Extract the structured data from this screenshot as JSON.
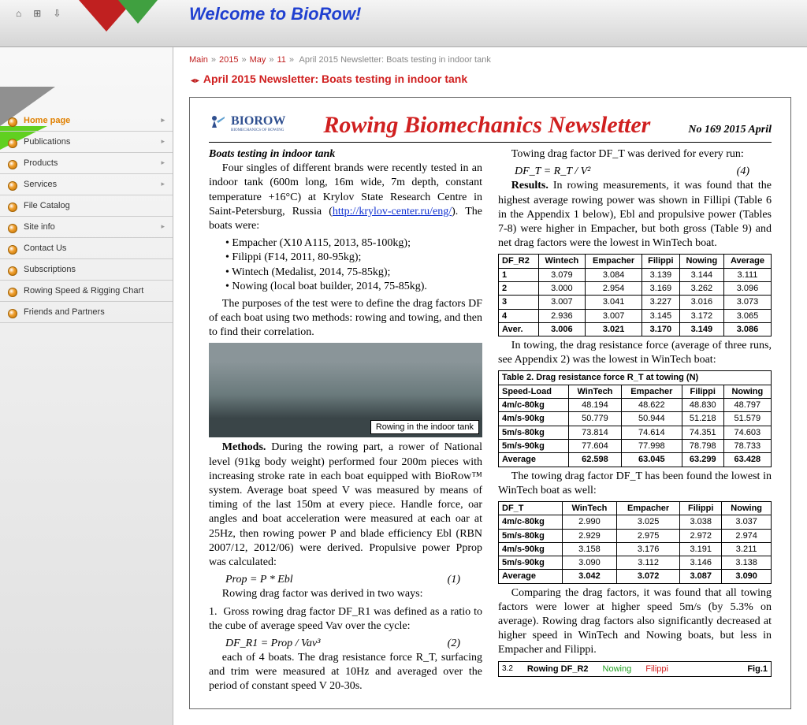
{
  "header": {
    "title": "Welcome to BioRow!"
  },
  "sidebar": {
    "items": [
      {
        "label": "Home page",
        "active": true,
        "expand": true
      },
      {
        "label": "Publications",
        "active": false,
        "expand": true
      },
      {
        "label": "Products",
        "active": false,
        "expand": true
      },
      {
        "label": "Services",
        "active": false,
        "expand": true
      },
      {
        "label": "File Catalog",
        "active": false,
        "expand": false
      },
      {
        "label": "Site info",
        "active": false,
        "expand": true
      },
      {
        "label": "Contact Us",
        "active": false,
        "expand": false
      },
      {
        "label": "Subscriptions",
        "active": false,
        "expand": false
      },
      {
        "label": "Rowing Speed & Rigging Chart",
        "active": false,
        "expand": false
      },
      {
        "label": "Friends and Partners",
        "active": false,
        "expand": false
      }
    ]
  },
  "breadcrumb": {
    "parts": [
      "Main",
      "2015",
      "May",
      "11"
    ],
    "current": "April 2015 Newsletter: Boats testing in indoor tank"
  },
  "page": {
    "title": "April 2015 Newsletter: Boats testing in indoor tank"
  },
  "doc": {
    "logo": "BIOROW",
    "logo_sub": "BIOMECHANICS OF ROWING",
    "title": "Rowing Biomechanics Newsletter",
    "issue": "No 169 2015 April",
    "section_title": "Boats testing in indoor tank",
    "intro": "Four singles of different brands were recently tested in an indoor tank (600m long, 16m wide, 7m depth, constant temperature +16°C) at Krylov State Research Centre in Saint-Petersburg, Russia (",
    "intro_link": "http://krylov-center.ru/eng/",
    "intro2": "). The boats were:",
    "boats": [
      "Empacher (X10 A115, 2013, 85-100kg);",
      "Filippi (F14, 2011, 80-95kg);",
      "Wintech (Medalist, 2014, 75-85kg);",
      "Nowing (local boat builder, 2014, 75-85kg)."
    ],
    "purpose": "The purposes of the test were to define the drag factors DF of each boat using two methods: rowing and towing, and then to find their correlation.",
    "fig_caption": "Rowing in the indoor tank",
    "methods_label": "Methods.",
    "methods": " During the rowing part, a rower of National level (91kg body weight) performed four 200m pieces with increasing stroke rate in each boat equipped with BioRow™ system. Average boat speed V was measured by means of timing of the last 150m at every piece. Handle force, oar angles and boat acceleration were measured at each oar at 25Hz, then rowing power P and blade efficiency Ebl (RBN 2007/12, 2012/06) were derived. Propulsive power Pprop was calculated:",
    "eq1": "Prop = P * Ebl",
    "eq1n": "(1)",
    "drag_intro": "Rowing drag factor was derived in two ways:",
    "gross": "Gross rowing drag factor DF_R1 was defined as a ratio to the cube of average speed Vav over the cycle:",
    "eq2": "DF_R1 = Prop / Vav³",
    "eq2n": "(2)",
    "col2_intro": "each of 4 boats. The drag resistance force R_T, surfacing and trim were measured at 10Hz and averaged over the period of constant speed V 20-30s.",
    "towing_line": "Towing drag factor DF_T was derived for every run:",
    "eq4": "DF_T = R_T / V²",
    "eq4n": "(4)",
    "results_label": "Results.",
    "results": " In rowing measurements, it was found that the highest average rowing power was shown in Fillipi (Table 6 in the Appendix 1 below), Ebl and propulsive power (Tables 7-8) were higher in Empacher, but both gross (Table 9) and net drag factors were the lowest in WinTech boat.",
    "towing_text": "In towing, the drag resistance force (average of three runs, see Appendix 2) was the lowest in WinTech boat:",
    "table2_caption": "Table 2. Drag resistance force R_T at towing (N)",
    "dft_text": "The towing drag factor DF_T has been found the lowest in WinTech boat as well:",
    "compare": "Comparing the drag factors, it was found that all towing factors were lower at higher speed 5m/s (by 5.3% on average). Rowing drag factors also significantly decreased at higher speed in WinTech and Nowing boats, but less in Empacher and Filippi.",
    "fig1": {
      "y": "3.2",
      "title": "Rowing DF_R2",
      "series": [
        "Nowing",
        "Filippi"
      ],
      "label": "Fig.1"
    }
  },
  "chart_data": [
    {
      "type": "table",
      "title": "DF_R2",
      "categories": [
        "Wintech",
        "Empacher",
        "Filippi",
        "Nowing",
        "Average"
      ],
      "rows": [
        {
          "label": "1",
          "values": [
            3.079,
            3.084,
            3.139,
            3.144,
            3.111
          ]
        },
        {
          "label": "2",
          "values": [
            3.0,
            2.954,
            3.169,
            3.262,
            3.096
          ]
        },
        {
          "label": "3",
          "values": [
            3.007,
            3.041,
            3.227,
            3.016,
            3.073
          ]
        },
        {
          "label": "4",
          "values": [
            2.936,
            3.007,
            3.145,
            3.172,
            3.065
          ]
        },
        {
          "label": "Aver.",
          "values": [
            3.006,
            3.021,
            3.17,
            3.149,
            3.086
          ]
        }
      ]
    },
    {
      "type": "table",
      "title": "Table 2. Drag resistance force R_T at towing (N)",
      "categories": [
        "WinTech",
        "Empacher",
        "Filippi",
        "Nowing"
      ],
      "row_label": "Speed-Load",
      "rows": [
        {
          "label": "4m/c-80kg",
          "values": [
            48.194,
            48.622,
            48.83,
            48.797
          ]
        },
        {
          "label": "4m/s-90kg",
          "values": [
            50.779,
            50.944,
            51.218,
            51.579
          ]
        },
        {
          "label": "5m/s-80kg",
          "values": [
            73.814,
            74.614,
            74.351,
            74.603
          ]
        },
        {
          "label": "5m/s-90kg",
          "values": [
            77.604,
            77.998,
            78.798,
            78.733
          ]
        },
        {
          "label": "Average",
          "values": [
            62.598,
            63.045,
            63.299,
            63.428
          ]
        }
      ]
    },
    {
      "type": "table",
      "title": "DF_T",
      "categories": [
        "WinTech",
        "Empacher",
        "Filippi",
        "Nowing"
      ],
      "rows": [
        {
          "label": "4m/c-80kg",
          "values": [
            2.99,
            3.025,
            3.038,
            3.037
          ]
        },
        {
          "label": "5m/s-80kg",
          "values": [
            2.929,
            2.975,
            2.972,
            2.974
          ]
        },
        {
          "label": "4m/s-90kg",
          "values": [
            3.158,
            3.176,
            3.191,
            3.211
          ]
        },
        {
          "label": "5m/s-90kg",
          "values": [
            3.09,
            3.112,
            3.146,
            3.138
          ]
        },
        {
          "label": "Average",
          "values": [
            3.042,
            3.072,
            3.087,
            3.09
          ]
        }
      ]
    }
  ]
}
